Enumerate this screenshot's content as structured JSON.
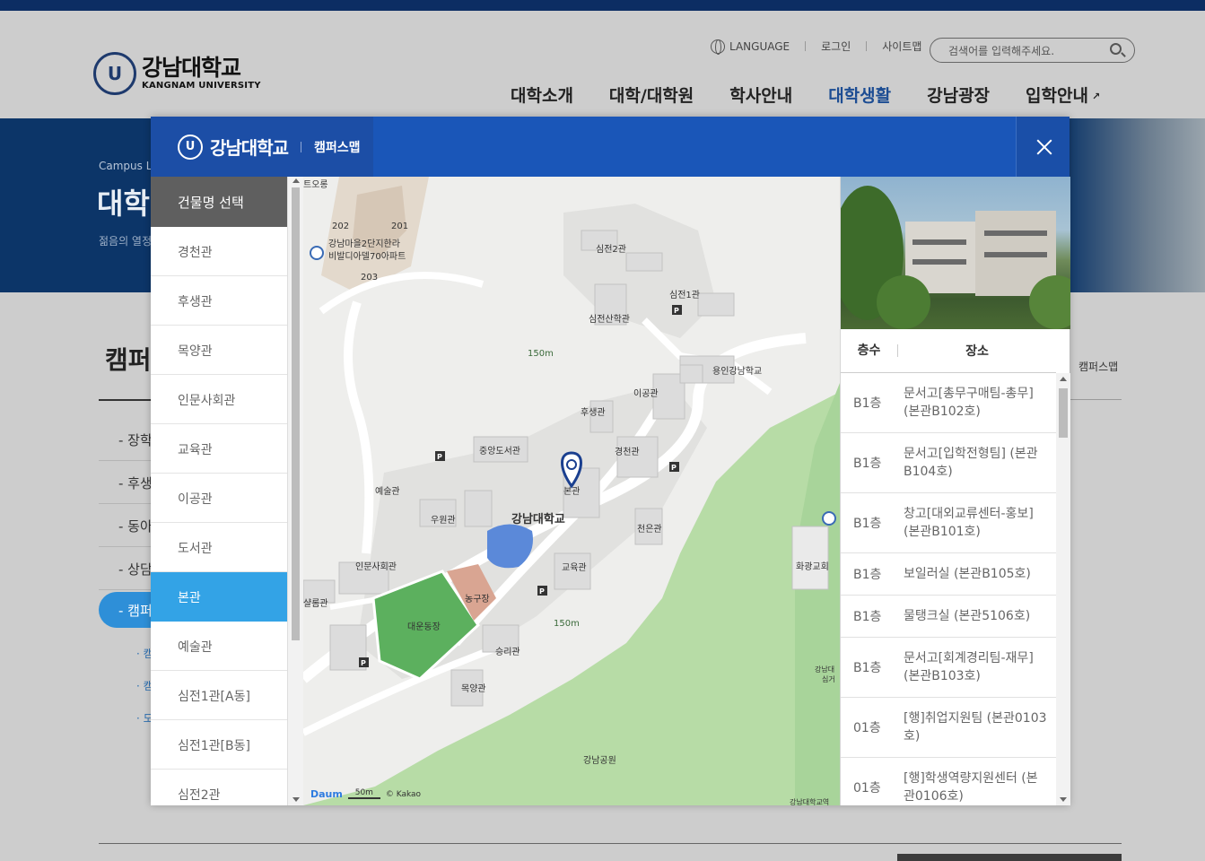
{
  "site": {
    "logo_ko": "강남대학교",
    "logo_en": "KANGNAM UNIVERSITY",
    "emblem": "U",
    "util": {
      "language": "LANGUAGE",
      "login": "로그인",
      "sitemap": "사이트맵"
    },
    "search_placeholder": "검색어를 입력해주세요.",
    "gnb": [
      "대학소개",
      "대학/대학원",
      "학사안내",
      "대학생활",
      "강남광장",
      "입학안내"
    ],
    "gnb_active": "대학생활",
    "visual": {
      "crumb": "Campus L",
      "title": "대학",
      "subtitle": "젊음의 열정"
    },
    "content_title": "캠퍼",
    "breadcrumb_current": "캠퍼스맵",
    "lnb": [
      "- 장학",
      "- 후생",
      "- 동아",
      "- 상담"
    ],
    "lnb_active": "- 캠퍼",
    "lnb_sub": [
      "· 캠",
      "· 캠",
      "· 도"
    ]
  },
  "modal": {
    "brand": "강남대학교",
    "emblem": "U",
    "title": "캠퍼스맵",
    "building_header": "건물명 선택",
    "buildings": [
      "경천관",
      "후생관",
      "목양관",
      "인문사회관",
      "교육관",
      "이공관",
      "도서관",
      "본관",
      "예술관",
      "심전1관[A동]",
      "심전1관[B동]",
      "심전2관"
    ],
    "active_building": "본관",
    "map": {
      "labels": {
        "top_left": "트오롱",
        "apt_202": "202",
        "apt_201": "201",
        "apt_203": "203",
        "apt_name_1": "강남마을2단지한라",
        "apt_name_2": "비발디아델70아파트",
        "simjeon2": "심전2관",
        "simjeon1": "심전1관",
        "simjeonsan": "심전산학관",
        "distance_top": "150m",
        "yongin_school": "용인강남학교",
        "igonggwan": "이공관",
        "husaeng": "후생관",
        "library": "중앙도서관",
        "gyeongcheon": "경천관",
        "yesul": "예술관",
        "bongwan": "본관",
        "uwon": "우원관",
        "university": "강남대학교",
        "cheoneun": "천은관",
        "hwagwang": "화광교회",
        "inmun": "인문사회관",
        "gyoyuk": "교육관",
        "salle": "샬롬관",
        "basketball": "농구장",
        "stadium": "대운동장",
        "distance_bottom": "150m",
        "seungri": "승리관",
        "mokyang": "목양관",
        "park": "강남공원",
        "kangnam_small_1": "강남대",
        "kangnam_small_2": "심거",
        "bottom_right": "강남대학교역"
      },
      "footer": {
        "brand": "Daum",
        "scale": "50m",
        "copyright": "© Kakao"
      }
    },
    "panel": {
      "header_floor": "층수",
      "header_place": "장소",
      "rows": [
        {
          "floor": "B1층",
          "place": "문서고[총무구매팀-총무](본관B102호)"
        },
        {
          "floor": "B1층",
          "place": "문서고[입학전형팀] (본관B104호)"
        },
        {
          "floor": "B1층",
          "place": "창고[대외교류센터-홍보](본관B101호)"
        },
        {
          "floor": "B1층",
          "place": "보일러실 (본관B105호)"
        },
        {
          "floor": "B1층",
          "place": "물탱크실 (본관5106호)"
        },
        {
          "floor": "B1층",
          "place": "문서고[회계경리팀-재무](본관B103호)"
        },
        {
          "floor": "01층",
          "place": "[행]취업지원팀 (본관0103호)"
        },
        {
          "floor": "01층",
          "place": "[행]학생역량지원센터 (본관0106호)"
        }
      ]
    }
  },
  "colors": {
    "modal_header": "#1a56b8",
    "active_building": "#33a3e6",
    "building_header": "#5f5f5f",
    "visual_bg": "#0c3568",
    "map_green": "#a8d49a",
    "map_marker": "#1a3f8f"
  }
}
